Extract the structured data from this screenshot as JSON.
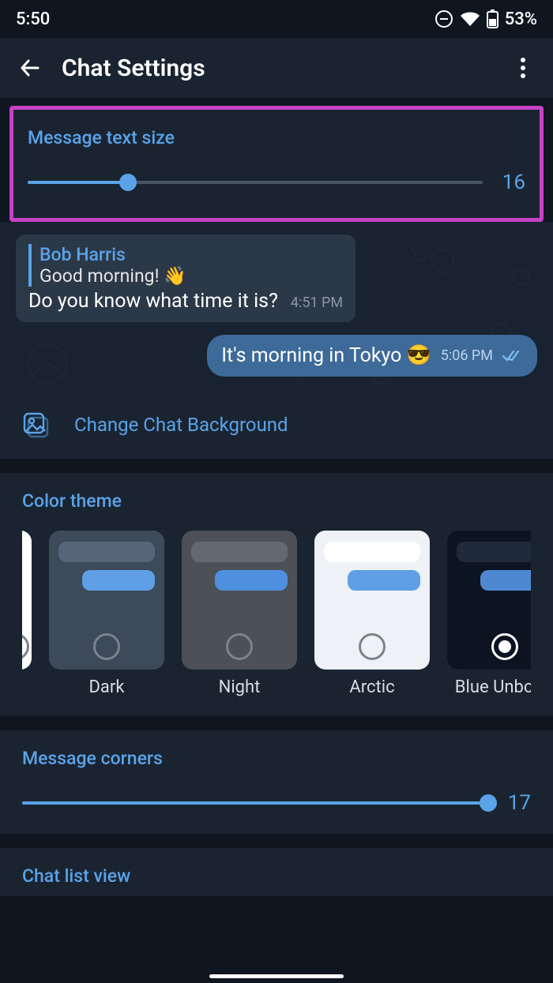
{
  "status": {
    "time": "5:50",
    "battery_pct": "53%"
  },
  "header": {
    "title": "Chat Settings"
  },
  "text_size": {
    "title": "Message text size",
    "value": "16",
    "fill_pct": 22
  },
  "preview": {
    "reply_name": "Bob Harris",
    "reply_text": "Good morning! 👋",
    "in_text": "Do you know what time it is?",
    "in_time": "4:51 PM",
    "out_text": "It's morning in Tokyo 😎",
    "out_time": "5:06 PM"
  },
  "change_bg": {
    "label": "Change Chat Background"
  },
  "themes": {
    "title": "Color theme",
    "items": [
      {
        "label": "",
        "bg": "#ffffff",
        "b1": "#e0e4ea",
        "b2": "#58a6f0",
        "selected": false
      },
      {
        "label": "Dark",
        "bg": "#3c4a5a",
        "b1": "#566577",
        "b2": "#5f9fe6",
        "selected": false
      },
      {
        "label": "Night",
        "bg": "#4c5057",
        "b1": "#64696f",
        "b2": "#4f8fe0",
        "selected": false
      },
      {
        "label": "Arctic",
        "bg": "#eef1f5",
        "b1": "#ffffff",
        "b2": "#5f9fe6",
        "selected": false
      },
      {
        "label": "Blue Unbou…",
        "bg": "#0c1422",
        "b1": "#1f2a3a",
        "b2": "#4d88d0",
        "selected": true
      }
    ]
  },
  "corners": {
    "title": "Message corners",
    "value": "17",
    "fill_pct": 100
  },
  "chat_list": {
    "title": "Chat list view"
  }
}
